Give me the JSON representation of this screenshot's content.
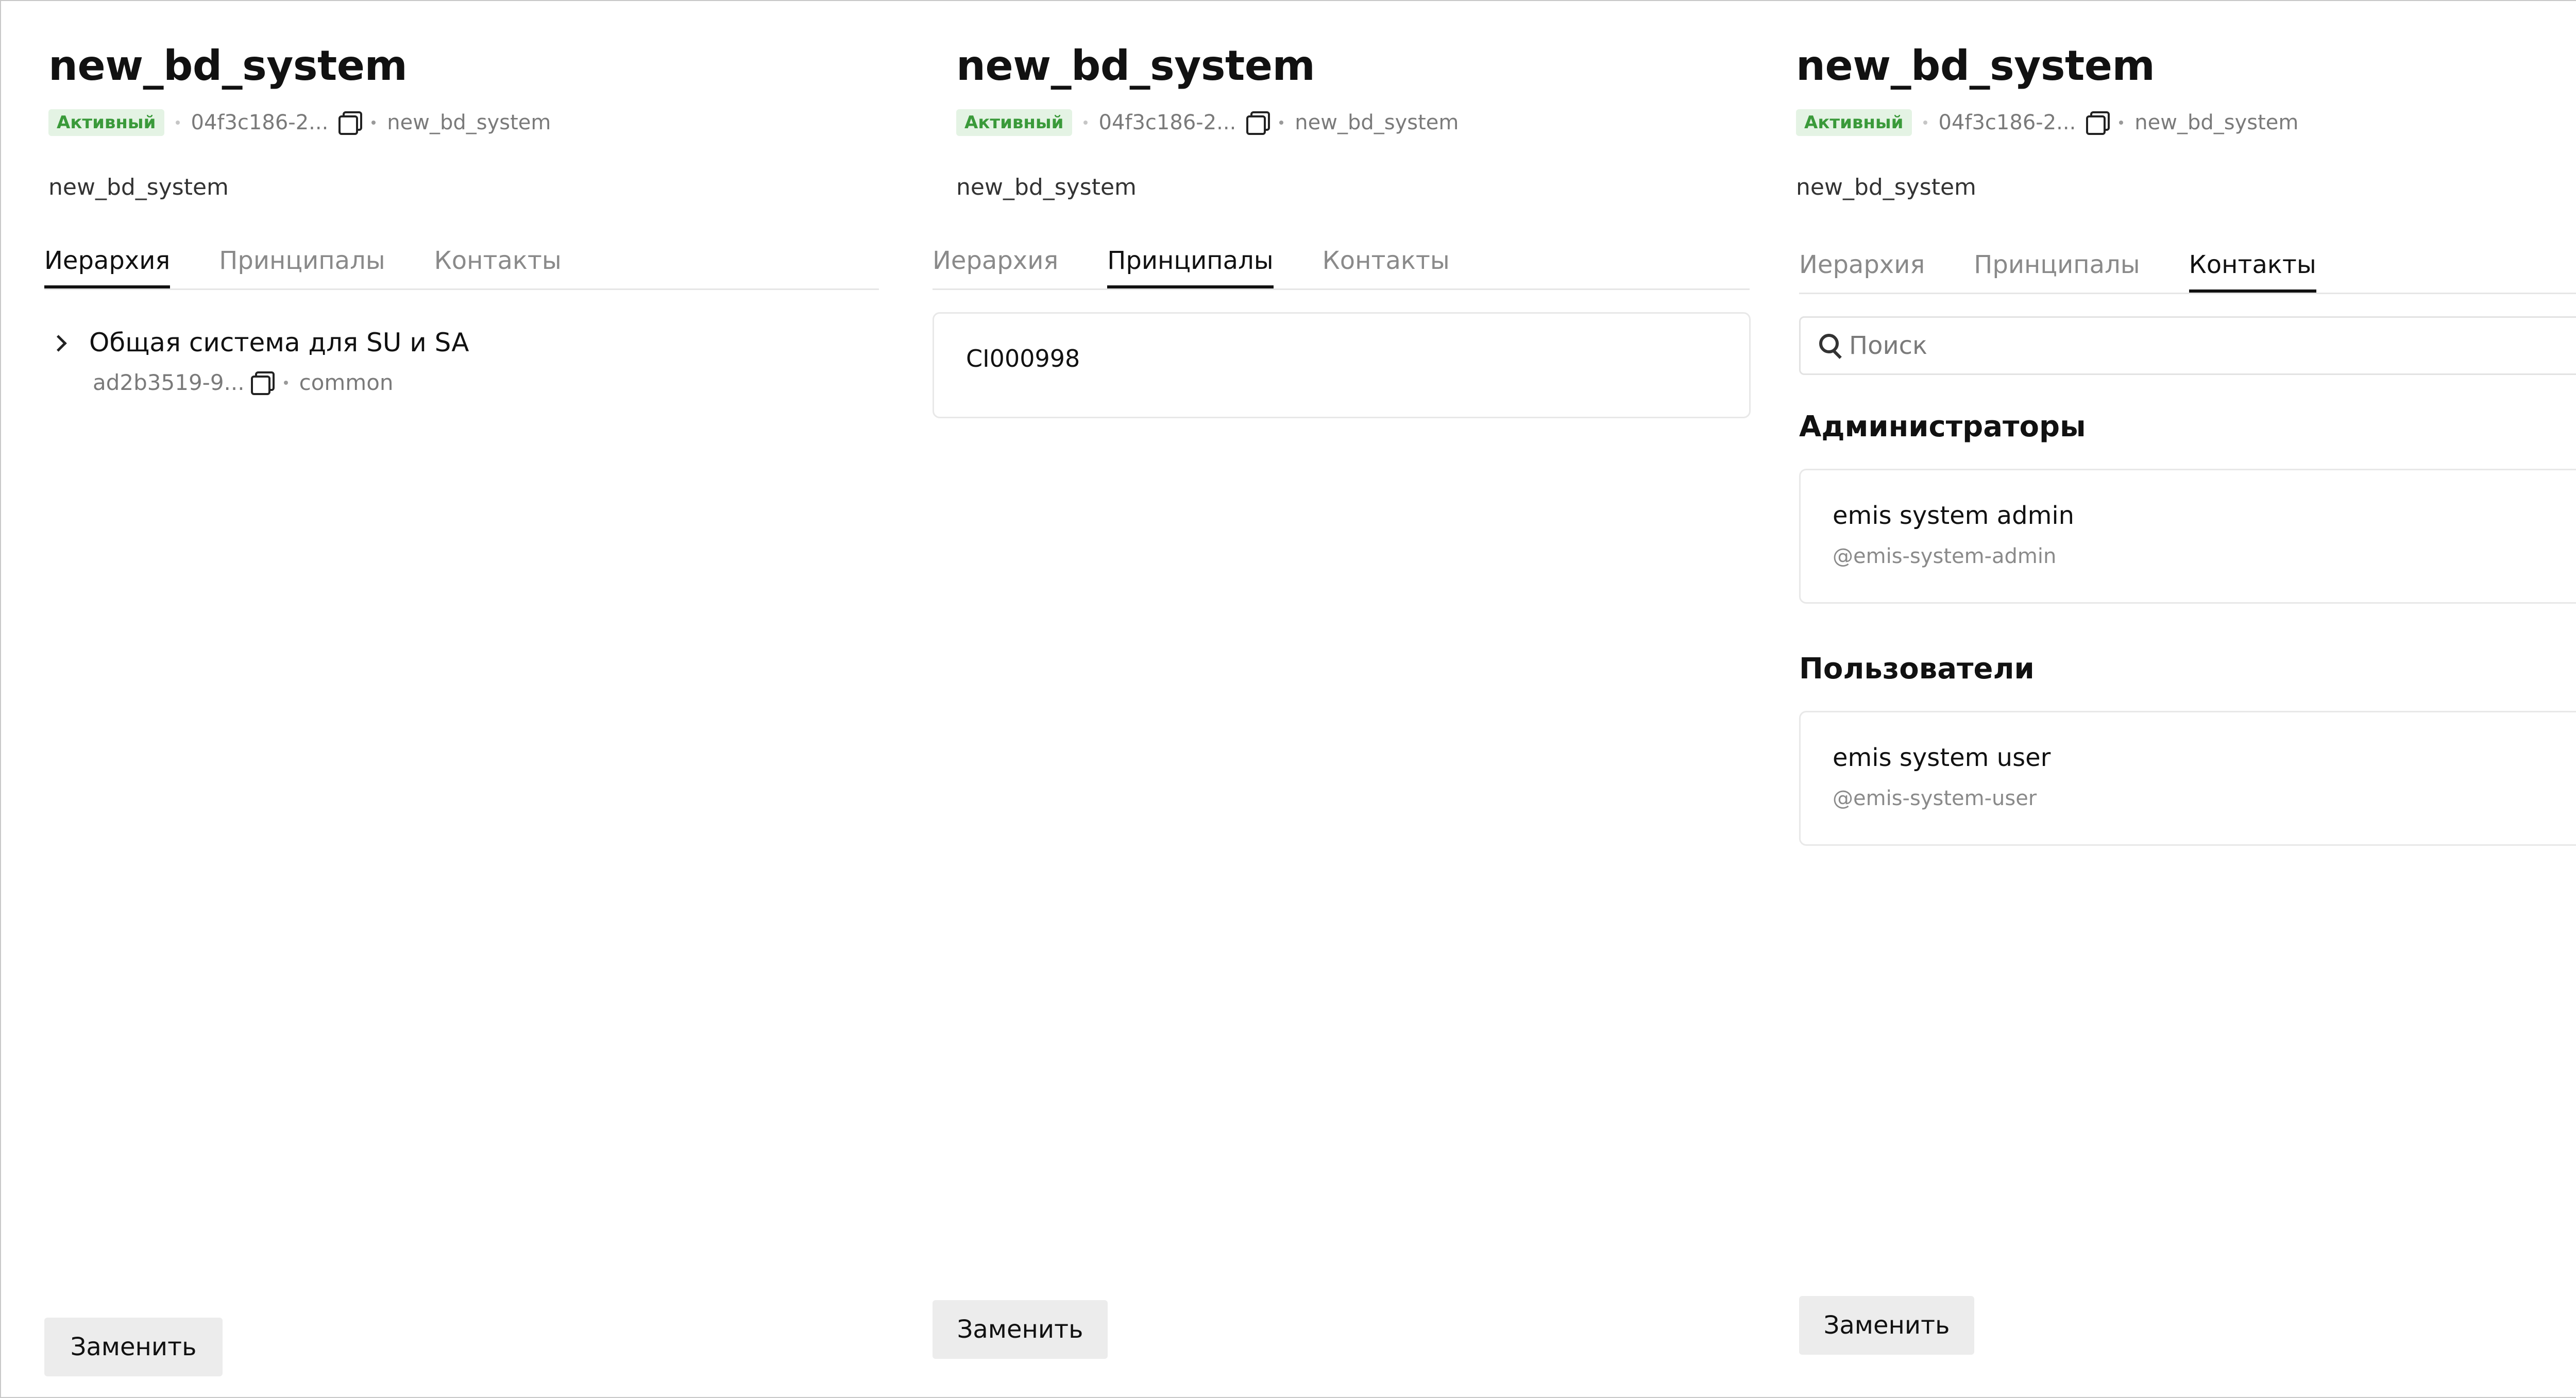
{
  "panels": [
    {
      "title": "new_bd_system",
      "status": "Активный",
      "id_short": "04f3c186-2...",
      "code": "new_bd_system",
      "description": "new_bd_system",
      "tabs": [
        "Иерархия",
        "Принципалы",
        "Контакты"
      ],
      "active_tab": "Иерархия",
      "hierarchy": {
        "label": "Общая система для SU и SA",
        "id_short": "ad2b3519-9...",
        "type": "common"
      },
      "button": "Заменить"
    },
    {
      "title": "new_bd_system",
      "status": "Активный",
      "id_short": "04f3c186-2...",
      "code": "new_bd_system",
      "description": "new_bd_system",
      "tabs": [
        "Иерархия",
        "Принципалы",
        "Контакты"
      ],
      "active_tab": "Принципалы",
      "principals": [
        "CI000998"
      ],
      "button": "Заменить"
    },
    {
      "title": "new_bd_system",
      "status": "Активный",
      "id_short": "04f3c186-2...",
      "code": "new_bd_system",
      "description": "new_bd_system",
      "tabs": [
        "Иерархия",
        "Принципалы",
        "Контакты"
      ],
      "active_tab": "Контакты",
      "search_placeholder": "Поиск",
      "admins_title": "Администраторы",
      "admins": [
        {
          "name": "emis system admin",
          "handle": "@emis-system-admin"
        }
      ],
      "users_title": "Пользователи",
      "users": [
        {
          "name": "emis system user",
          "handle": "@emis-system-user"
        }
      ],
      "button": "Заменить"
    }
  ],
  "icons": {
    "copy": "copy-icon",
    "chevron": "chevron-right-icon",
    "search": "search-icon"
  },
  "colors": {
    "status_bg": "#e4f3e4",
    "status_text": "#3a9a3a",
    "button_bg": "#ececec"
  }
}
